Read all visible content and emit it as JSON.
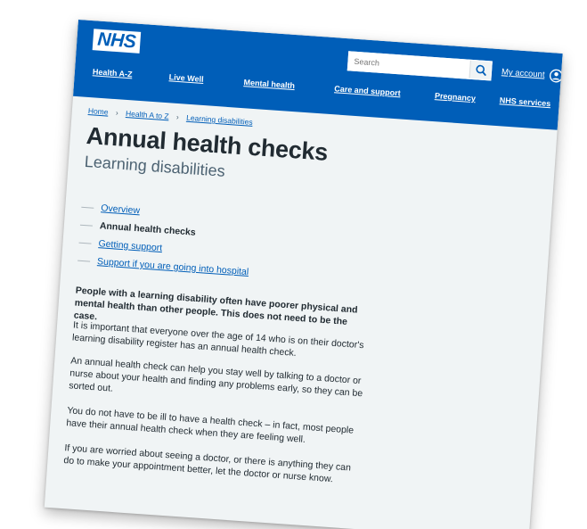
{
  "header": {
    "logo": "NHS",
    "search_placeholder": "Search",
    "account_label": "My account",
    "colors": {
      "brand_blue": "#005eb8",
      "background": "#f0f4f5",
      "text": "#212b32",
      "secondary_text": "#4c6272"
    },
    "nav": [
      {
        "label": "Health A-Z"
      },
      {
        "label": "Live Well"
      },
      {
        "label": "Mental health"
      },
      {
        "label": "Care and support"
      },
      {
        "label": "Pregnancy"
      },
      {
        "label": "NHS services"
      }
    ]
  },
  "breadcrumb": {
    "items": [
      {
        "label": "Home"
      },
      {
        "label": "Health A to Z"
      },
      {
        "label": "Learning disabilities"
      }
    ]
  },
  "page": {
    "title": "Annual health checks",
    "subtitle": "Learning disabilities"
  },
  "contents": [
    {
      "label": "Overview",
      "current": false
    },
    {
      "label": "Annual health checks",
      "current": true
    },
    {
      "label": "Getting support",
      "current": false
    },
    {
      "label": "Support if you are going into hospital",
      "current": false
    }
  ],
  "body": {
    "lead": "People with a learning disability often have poorer physical and mental health than other people. This does not need to be the case.",
    "paragraphs": [
      "It is important that everyone over the age of 14 who is on their doctor's learning disability register has an annual health check.",
      "An annual health check can help you stay well by talking to a doctor or nurse about your health and finding any problems early, so they can be sorted out.",
      "You do not have to be ill to have a health check – in fact, most people have their annual health check when they are feeling well.",
      "If you are worried about seeing a doctor, or there is anything they can do to make your appointment better, let the doctor or nurse know."
    ]
  },
  "icons": {
    "search": "search-icon",
    "account": "user-circle-icon"
  }
}
